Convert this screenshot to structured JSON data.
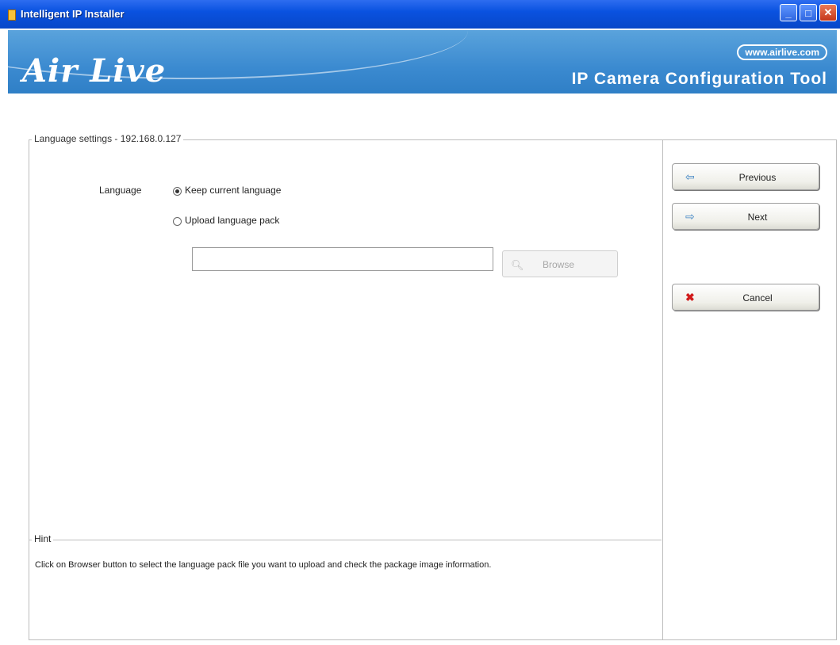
{
  "window": {
    "title": "Intelligent IP Installer",
    "controls": {
      "minimize": "_",
      "maximize": "□",
      "close": "✕"
    }
  },
  "banner": {
    "logo": "Air Live",
    "website": "www.airlive.com",
    "product": "IP Camera Configuration Tool"
  },
  "settings": {
    "group_title": "Language settings - 192.168.0.127",
    "language_label": "Language",
    "options": [
      {
        "label": "Keep current language",
        "selected": true
      },
      {
        "label": "Upload language pack",
        "selected": false
      }
    ],
    "file_path_value": "",
    "browse_label": "Browse",
    "browse_enabled": false
  },
  "hint": {
    "title": "Hint",
    "text": "Click on Browser button to select the language pack file you want to upload and check the package image information."
  },
  "nav": {
    "previous_label": "Previous",
    "next_label": "Next",
    "cancel_label": "Cancel"
  },
  "icons": {
    "app": "app-icon",
    "browse": "magnifier-icon",
    "previous": "arrow-left-icon",
    "next": "arrow-right-icon",
    "cancel": "x-icon"
  },
  "colors": {
    "titlebar": "#0a52e0",
    "banner": "#3b8ad0",
    "cancel_icon": "#d11b1b",
    "arrow_icon": "#3f84c4"
  }
}
